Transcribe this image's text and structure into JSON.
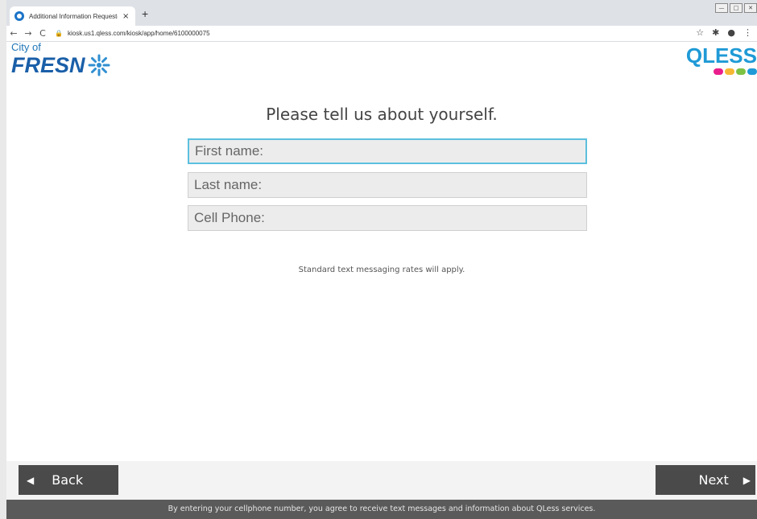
{
  "browser": {
    "tab_title": "Additional Information Requeste",
    "tab_close": "×",
    "new_tab": "+",
    "url": "kiosk.us1.qless.com/kiosk/app/home/6100000075",
    "back_arrow": "←",
    "forward_arrow": "→",
    "reload": "C",
    "lock": "🔒",
    "star": "☆",
    "extensions": "✱",
    "profile": "●",
    "menu": "⋮",
    "win_min": "—",
    "win_max": "□",
    "win_close": "✕"
  },
  "header": {
    "city_of": "City of",
    "fresno": "FRESN",
    "qless": "QLESS",
    "qless_dot_colors": [
      "#e91e8c",
      "#f7b733",
      "#7cc243",
      "#1f9ad6"
    ]
  },
  "form": {
    "heading": "Please tell us about yourself.",
    "first_name_placeholder": "First name:",
    "last_name_placeholder": "Last name:",
    "cell_phone_placeholder": "Cell Phone:",
    "note": "Standard text messaging rates will apply."
  },
  "nav": {
    "back_label": "Back",
    "next_label": "Next"
  },
  "footer": {
    "text": "By entering your cellphone number, you agree to receive text messages and information about QLess services."
  },
  "colors": {
    "accent": "#5bc0de",
    "button_bg": "#4a4a4a",
    "footer_bg": "#5a5a5a"
  }
}
